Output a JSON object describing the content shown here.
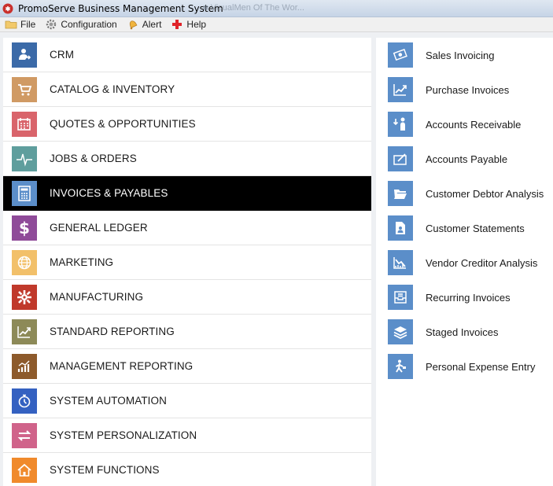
{
  "window": {
    "title": "PromoServe Business Management System",
    "ghost_title": "■ VisualMen Of The Wor..."
  },
  "menubar": [
    {
      "label": "File",
      "icon": "folder-icon"
    },
    {
      "label": "Configuration",
      "icon": "gear-icon"
    },
    {
      "label": "Alert",
      "icon": "bell-icon"
    },
    {
      "label": "Help",
      "icon": "help-cross-icon"
    }
  ],
  "modules": [
    {
      "label": "CRM",
      "icon": "crm-user-icon",
      "color": "#3b6aa8"
    },
    {
      "label": "CATALOG & INVENTORY",
      "icon": "cart-icon",
      "color": "#d09a64"
    },
    {
      "label": "QUOTES & OPPORTUNITIES",
      "icon": "calendar-icon",
      "color": "#d9646b"
    },
    {
      "label": "JOBS & ORDERS",
      "icon": "pulse-icon",
      "color": "#5f9e9d"
    },
    {
      "label": "INVOICES & PAYABLES",
      "icon": "calculator-icon",
      "color": "#5b8ec9",
      "selected": true
    },
    {
      "label": "GENERAL LEDGER",
      "icon": "dollar-icon",
      "color": "#8f4b99"
    },
    {
      "label": "MARKETING",
      "icon": "globe-icon",
      "color": "#f2c06a"
    },
    {
      "label": "MANUFACTURING",
      "icon": "gears-icon",
      "color": "#c0392b"
    },
    {
      "label": "STANDARD REPORTING",
      "icon": "chart-up-icon",
      "color": "#8d8a58"
    },
    {
      "label": "MANAGEMENT REPORTING",
      "icon": "bar-chart-icon",
      "color": "#8d5a2b"
    },
    {
      "label": "SYSTEM AUTOMATION",
      "icon": "stopwatch-icon",
      "color": "#3461c1"
    },
    {
      "label": "SYSTEM PERSONALIZATION",
      "icon": "swap-arrows-icon",
      "color": "#d0638a"
    },
    {
      "label": "SYSTEM FUNCTIONS",
      "icon": "home-icon",
      "color": "#f08a2c"
    }
  ],
  "submodules": [
    {
      "label": "Sales Invoicing",
      "icon": "money-icon"
    },
    {
      "label": "Purchase Invoices",
      "icon": "chart-up-icon"
    },
    {
      "label": "Accounts Receivable",
      "icon": "receive-person-icon"
    },
    {
      "label": "Accounts Payable",
      "icon": "edit-box-icon"
    },
    {
      "label": "Customer Debtor Analysis",
      "icon": "folder-open-icon"
    },
    {
      "label": "Customer Statements",
      "icon": "file-person-icon"
    },
    {
      "label": "Vendor Creditor Analysis",
      "icon": "chart-down-icon"
    },
    {
      "label": "Recurring Invoices",
      "icon": "tray-icon"
    },
    {
      "label": "Staged Invoices",
      "icon": "layers-icon"
    },
    {
      "label": "Personal Expense Entry",
      "icon": "walking-person-icon"
    }
  ],
  "colors": {
    "submodule_icon_bg": "#5b8ec9",
    "selected_row_bg": "#000000"
  }
}
